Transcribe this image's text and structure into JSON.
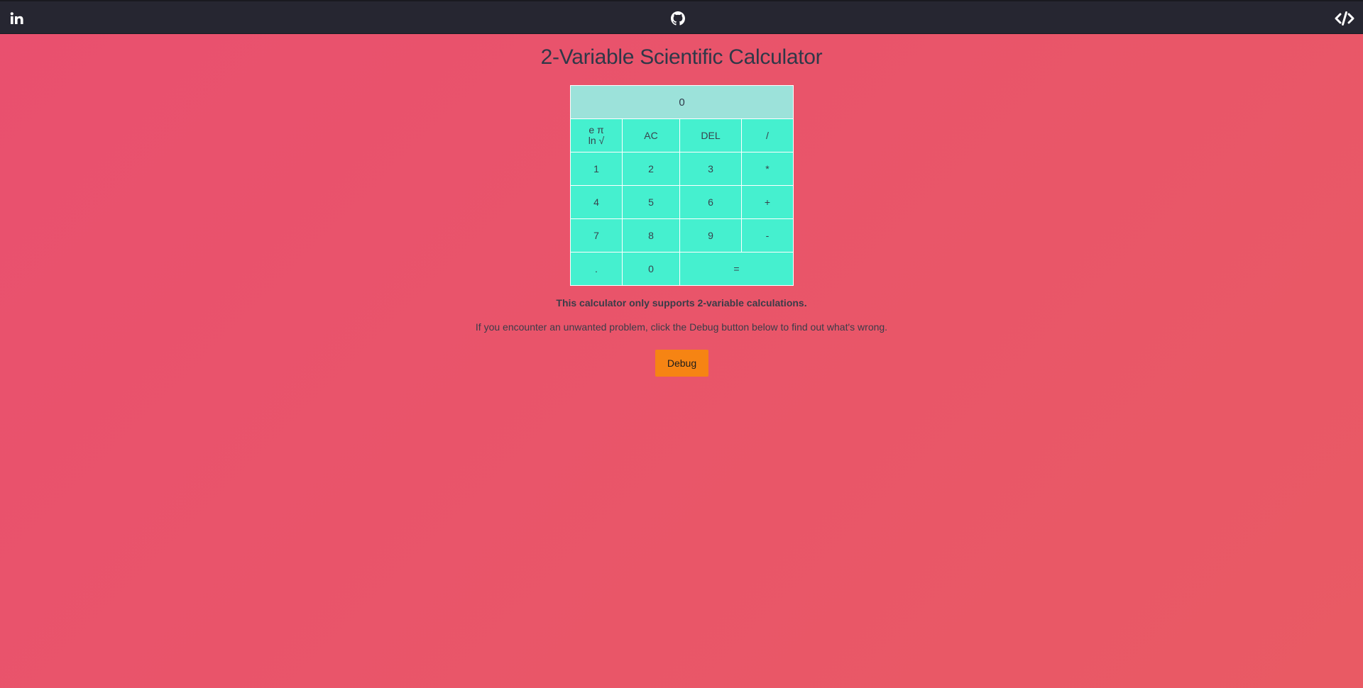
{
  "navbar": {
    "left_icon": "linkedin-icon",
    "center_icon": "github-icon",
    "right_icon": "code-icon",
    "background": "#262631"
  },
  "page": {
    "title": "2-Variable Scientific Calculator",
    "note": "This calculator only supports 2-variable calculations.",
    "hint": "If you encounter an unwanted problem, click the Debug button below to find out what's wrong.",
    "debug_label": "Debug"
  },
  "calculator": {
    "display_value": "0",
    "keys": {
      "sci_line1": "e π",
      "sci_line2": "ln √",
      "ac": "AC",
      "del": "DEL",
      "divide": "/",
      "one": "1",
      "two": "2",
      "three": "3",
      "multiply": "*",
      "four": "4",
      "five": "5",
      "six": "6",
      "plus": "+",
      "seven": "7",
      "eight": "8",
      "nine": "9",
      "minus": "-",
      "dot": ".",
      "zero": "0",
      "equals": "="
    }
  },
  "colors": {
    "accent_key": "#45f0cf",
    "display_bg": "#9ce2da",
    "debug_button": "#f68413",
    "background_start": "#e9506f",
    "background_end": "#e95a64"
  }
}
